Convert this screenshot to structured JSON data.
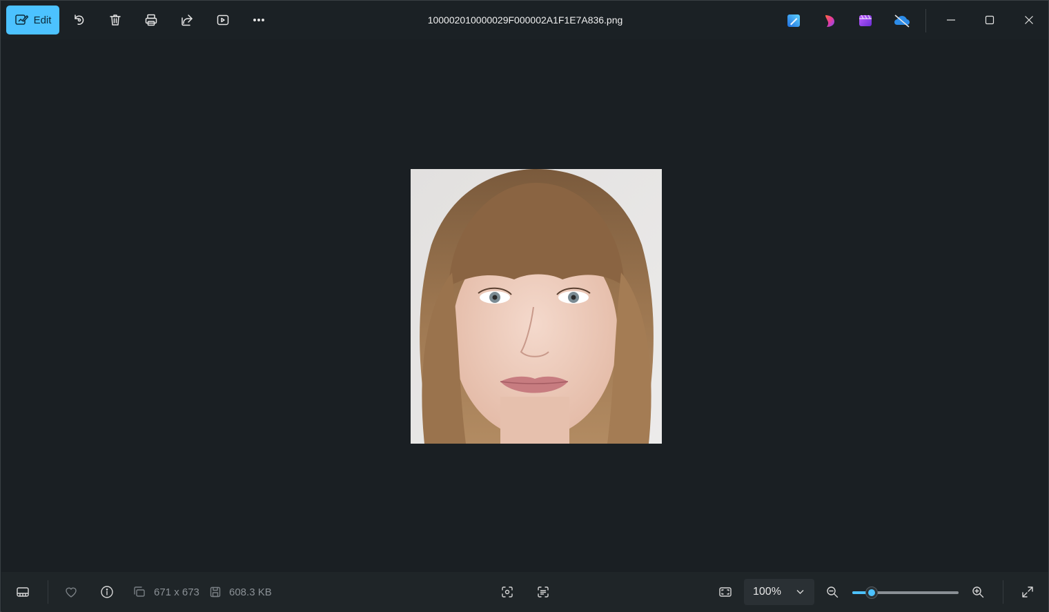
{
  "toolbar": {
    "edit_label": "Edit",
    "filename": "100002010000029F000002A1F1E7A836.png",
    "icons": [
      "rotate-icon",
      "delete-icon",
      "print-icon",
      "share-icon",
      "slideshow-icon",
      "more-icon"
    ],
    "apps": [
      "designer-icon",
      "clipchamp-icon",
      "copilot-icon",
      "onedrive-icon"
    ]
  },
  "status": {
    "dimensions": "671 x 673",
    "file_size": "608.3 KB",
    "zoom": "100%",
    "zoom_level": 0.18
  },
  "colors": {
    "accent": "#4cc2ff",
    "background": "#1b2125",
    "bottombar": "#1f2528"
  }
}
